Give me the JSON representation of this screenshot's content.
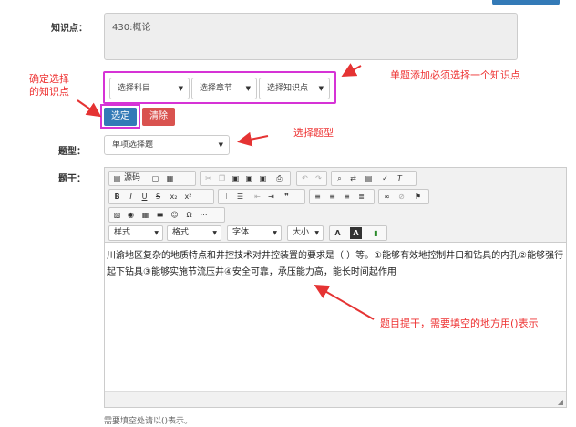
{
  "top_button": {
    "color": "#337ab7"
  },
  "knowledge": {
    "label": "知识点：",
    "value": "430:概论"
  },
  "selects": {
    "subject": "选择科目",
    "chapter": "选择章节",
    "point": "选择知识点"
  },
  "buttons": {
    "confirm": "选定",
    "clear": "清除"
  },
  "qtype": {
    "label": "题型：",
    "value": "单项选择题"
  },
  "stem": {
    "label": "题干：",
    "toolbar": {
      "source": "源码",
      "style": "样式",
      "format": "格式",
      "font": "字体",
      "size": "大小"
    },
    "content": "川渝地区复杂的地质特点和井控技术对井控装置的要求是（ ）等。①能够有效地控制井口和钻具的内孔②能够强行起下钻具③能够实施节流压井④安全可靠，承压能力高，能长时间起作用"
  },
  "hint": "需要填空处请以()表示。",
  "annotations": {
    "confirm_selection": "确定选择\n的知识点",
    "must_select": "单题添加必须选择一个知识点",
    "select_type": "选择题型",
    "stem_hint": "题目提干，需要填空的地方用()表示"
  },
  "colors": {
    "annotation": "#e53333",
    "highlight": "#d633d6",
    "confirm": "#337ab7",
    "clear": "#d9534f"
  }
}
